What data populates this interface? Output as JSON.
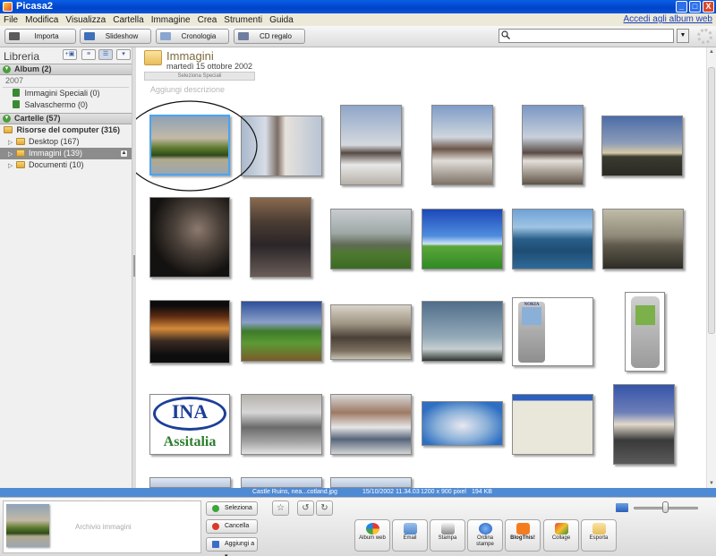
{
  "window": {
    "title": "Picasa2",
    "controls": [
      "_",
      "□",
      "X"
    ]
  },
  "menu": {
    "items": [
      "File",
      "Modifica",
      "Visualizza",
      "Cartella",
      "Immagine",
      "Crea",
      "Strumenti",
      "Guida"
    ],
    "web_link": "Accedi agli album web"
  },
  "toolbar": {
    "import": "Importa",
    "slideshow": "Slideshow",
    "timeline": "Cronologia",
    "cd_gift": "CD regalo",
    "search_value": "",
    "search_dropdown": "▼"
  },
  "sidebar": {
    "title": "Libreria",
    "album_section": "Album (2)",
    "year": "2007",
    "albums": [
      "Immagini Speciali (0)",
      "Salvaschermo (0)"
    ],
    "folders_section": "Cartelle (57)",
    "computer": "Risorse del computer (316)",
    "folders": [
      {
        "label": "Desktop (167)"
      },
      {
        "label": "Immagini (139)"
      },
      {
        "label": "Documenti (10)"
      }
    ]
  },
  "main": {
    "folder_title": "Immagini",
    "folder_date": "martedì 15 ottobre 2002",
    "select_special": "Seleziona Speciali",
    "add_description": "Aggiungi descrizione",
    "ina_label": "INA",
    "assitalia_label": "Assitalia",
    "nokia_label": "NOKIA"
  },
  "status": {
    "filename": "Castle Ruins, nea...cotland.jpg",
    "datetime": "15/10/2002 11.34.03",
    "dimensions": "1200 x 900 pixel",
    "size": "194 KB"
  },
  "tray": {
    "holder_label": "Archivio immagini",
    "select": "Seleziona",
    "cancel": "Cancella",
    "add_to": "Aggiungi a ▾",
    "actions": [
      "Album web",
      "Email",
      "Stampa",
      "Ordina stampe",
      "BlogThis!",
      "Collage",
      "Esporta"
    ]
  },
  "colors": {
    "title_bar": "#0a54d8",
    "status_bar": "#4f8ad4",
    "selection_border": "#4aa4f1",
    "sidebar_selected": "#8c8c8c"
  }
}
